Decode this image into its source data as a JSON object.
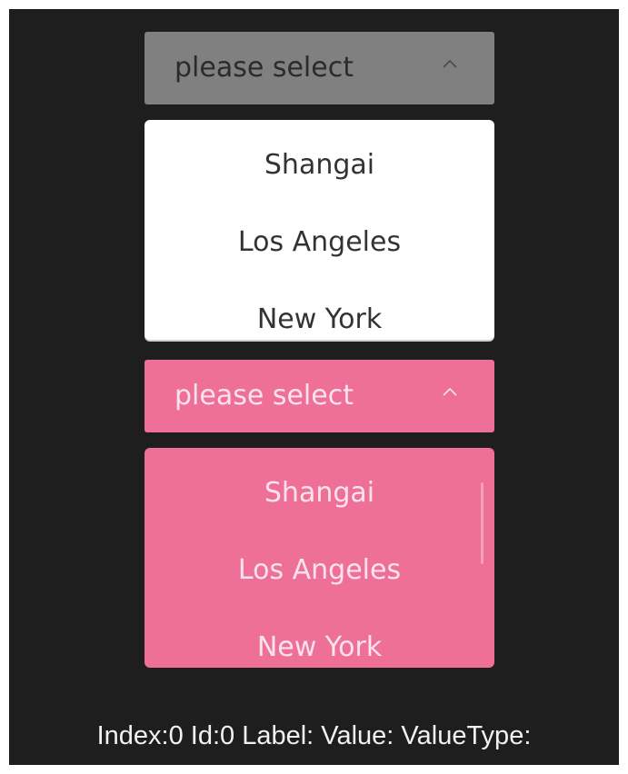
{
  "select_white": {
    "placeholder": "please select",
    "options": [
      "Shangai",
      "Los Angeles",
      "New York"
    ]
  },
  "select_pink": {
    "placeholder": "please select",
    "options": [
      "Shangai",
      "Los Angeles",
      "New York"
    ]
  },
  "status": {
    "text": "Index:0 Id:0 Label: Value: ValueType:"
  },
  "icons": {
    "select_open": "chevron-up-icon"
  },
  "colors": {
    "background": "#1e1e1e",
    "gray_header": "#808080",
    "pink": "#ee6f97",
    "white_panel": "#ffffff"
  }
}
